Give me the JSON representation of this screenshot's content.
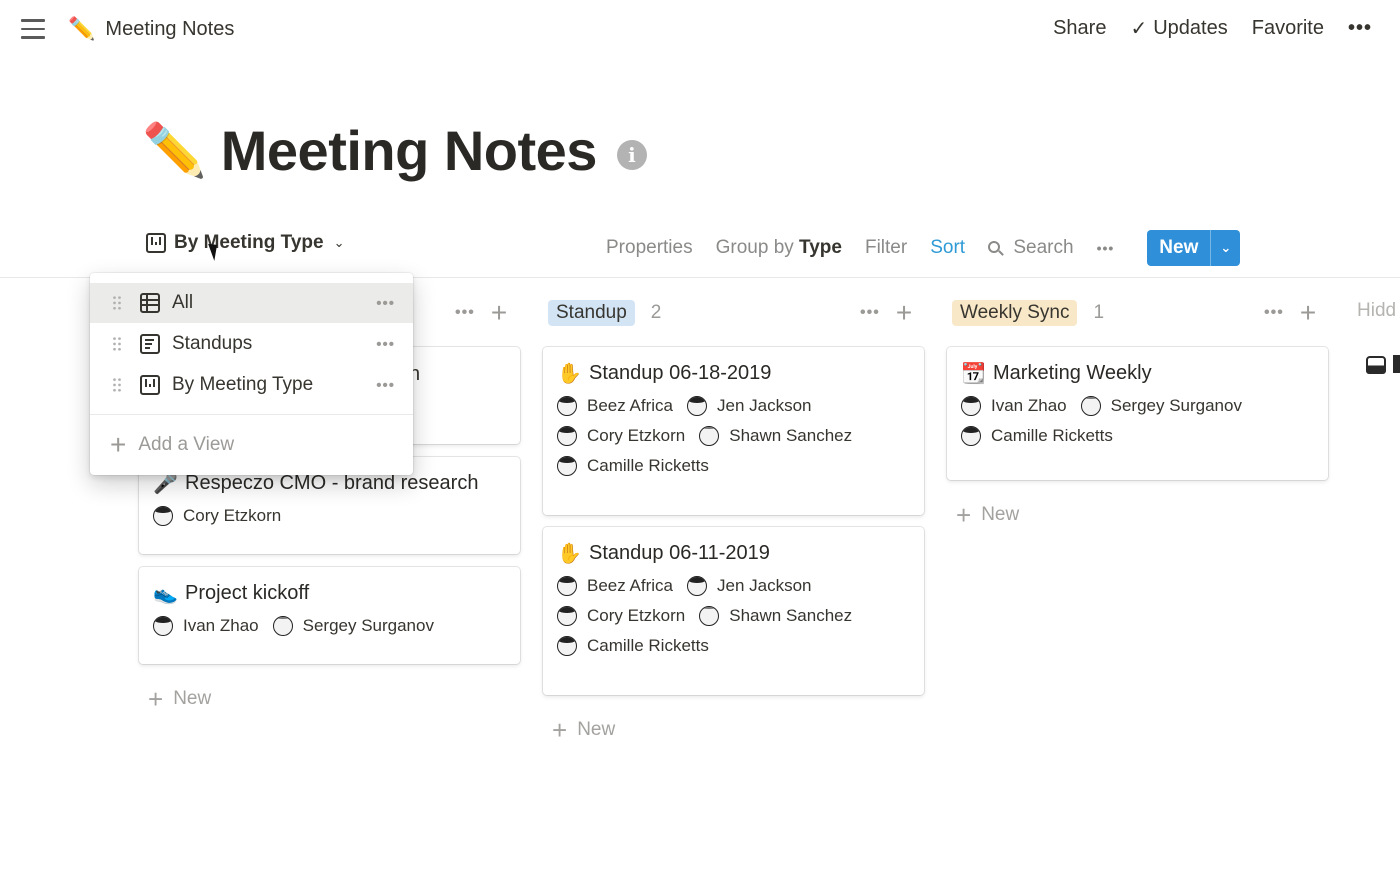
{
  "topbar": {
    "page_emoji": "✏️",
    "page_name": "Meeting Notes",
    "share": "Share",
    "updates": "Updates",
    "updates_check": "✓",
    "favorite": "Favorite",
    "more": "•••"
  },
  "page": {
    "emoji": "✏️",
    "title": "Meeting Notes",
    "info_glyph": "i"
  },
  "viewbar": {
    "current_view": "By Meeting Type",
    "chevron": "⌄",
    "properties": "Properties",
    "group_by_prefix": "Group by",
    "group_by_value": "Type",
    "filter": "Filter",
    "sort": "Sort",
    "search": "Search",
    "more": "•••",
    "new": "New",
    "new_dropdown": "⌄",
    "sort_color": "#2f9ad6",
    "new_color": "#2f8fd8"
  },
  "view_menu": {
    "items": [
      {
        "label": "All",
        "icon": "table-icon",
        "more": "•••",
        "active": true
      },
      {
        "label": "Standups",
        "icon": "list-icon",
        "more": "•••",
        "active": false
      },
      {
        "label": "By Meeting Type",
        "icon": "board-icon",
        "more": "•••",
        "active": false
      }
    ],
    "add_view": "Add a View",
    "add_glyph": "+"
  },
  "board": {
    "columns": [
      {
        "name": "",
        "partial_text": "n",
        "cards": [
          {
            "emoji": "🎤",
            "title": "Respeczo CMO - brand research",
            "people": [
              "Cory Etzkorn"
            ]
          },
          {
            "emoji": "👟",
            "title": "Project kickoff",
            "people": [
              "Ivan Zhao",
              "Sergey Surganov"
            ]
          }
        ],
        "new": "New"
      },
      {
        "name": "Standup",
        "count": "2",
        "color": "#d3e5f5",
        "cards": [
          {
            "emoji": "✋",
            "title": "Standup 06-18-2019",
            "people": [
              "Beez Africa",
              "Jen Jackson",
              "Cory Etzkorn",
              "Shawn Sanchez",
              "Camille Ricketts"
            ]
          },
          {
            "emoji": "✋",
            "title": "Standup 06-11-2019",
            "people": [
              "Beez Africa",
              "Jen Jackson",
              "Cory Etzkorn",
              "Shawn Sanchez",
              "Camille Ricketts"
            ]
          }
        ],
        "new": "New"
      },
      {
        "name": "Weekly Sync",
        "count": "1",
        "color": "#f8e8c8",
        "cards": [
          {
            "emoji": "📆",
            "title": "Marketing Weekly",
            "people": [
              "Ivan Zhao",
              "Sergey Surganov",
              "Camille Ricketts"
            ]
          }
        ],
        "new": "New"
      }
    ],
    "hidden_label": "Hidd",
    "col_more": "•••",
    "col_add": "+"
  }
}
